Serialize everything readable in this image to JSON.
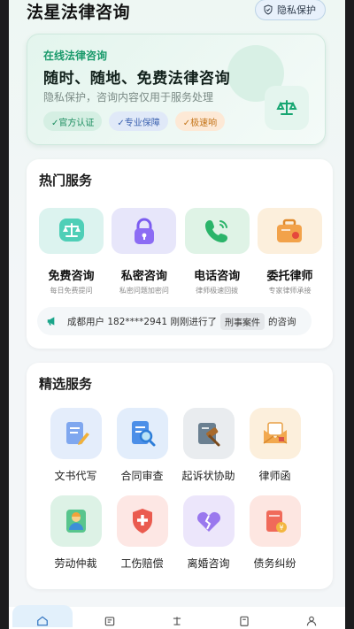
{
  "header": {
    "title": "法星法律咨询",
    "privacy_button": "隐私保护",
    "privacy_icon": "shield-check-icon"
  },
  "hero": {
    "subtitle": "在线法律咨询",
    "title": "随时、随地、免费法律咨询",
    "description": "隐私保护，咨询内容仅用于服务处理",
    "tags": [
      "✓官方认证",
      "✓专业保障",
      "✓极速响"
    ],
    "icon": "scales-icon",
    "accent_color": "#1a9a6b"
  },
  "hot_services": {
    "title": "热门服务",
    "items": [
      {
        "name": "免费咨询",
        "desc": "每日免费提问",
        "icon": "scales-icon"
      },
      {
        "name": "私密咨询",
        "desc": "私密问题加密问",
        "icon": "lock-icon"
      },
      {
        "name": "电话咨询",
        "desc": "律师极速回拨",
        "icon": "phone-icon"
      },
      {
        "name": "委托律师",
        "desc": "专家律师承接",
        "icon": "briefcase-icon"
      }
    ],
    "ticker": {
      "icon": "megaphone-icon",
      "prefix": "成都用户 182****2941 刚刚进行了",
      "case_type": "刑事案件",
      "suffix": "的咨询"
    }
  },
  "featured_services": {
    "title": "精选服务",
    "items": [
      {
        "name": "文书代写",
        "icon": "document-pen-icon"
      },
      {
        "name": "合同审查",
        "icon": "document-search-icon"
      },
      {
        "name": "起诉状协助",
        "icon": "gavel-icon"
      },
      {
        "name": "律师函",
        "icon": "envelope-icon"
      },
      {
        "name": "劳动仲裁",
        "icon": "worker-icon"
      },
      {
        "name": "工伤赔偿",
        "icon": "medical-shield-icon"
      },
      {
        "name": "离婚咨询",
        "icon": "broken-heart-icon"
      },
      {
        "name": "债务纠纷",
        "icon": "money-bag-icon"
      }
    ]
  },
  "bottom_nav": {
    "items": [
      "home-icon",
      "list-icon",
      "scales-icon",
      "document-icon",
      "user-icon"
    ],
    "active_index": 0
  }
}
